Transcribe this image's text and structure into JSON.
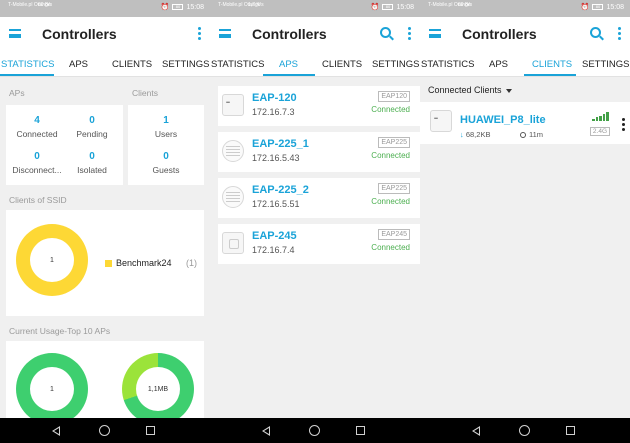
{
  "colors": {
    "accent": "#1aa3d8",
    "connected": "#4caf50",
    "donut_yellow": "#fdd835",
    "donut_green": "#3ecf6f",
    "donut_lime": "#9be33a"
  },
  "status_bars": [
    {
      "carrier": "T-Mobile.pl Orange",
      "speed": "60 B/s",
      "time": "15:08",
      "battery": "80"
    },
    {
      "carrier": "T-Mobile.pl Orange",
      "speed": "1,7 K/s",
      "time": "15:08",
      "battery": "80"
    },
    {
      "carrier": "T-Mobile.pl Orange",
      "speed": "69 B/s",
      "time": "15:08",
      "battery": "80"
    }
  ],
  "app_title": "Controllers",
  "tabs": [
    "STATISTICS",
    "APS",
    "CLIENTS",
    "SETTINGS"
  ],
  "statistics": {
    "aps_header": "APs",
    "clients_header": "Clients",
    "aps": [
      {
        "value": "4",
        "label": "Connected"
      },
      {
        "value": "0",
        "label": "Pending"
      },
      {
        "value": "0",
        "label": "Disconnect..."
      },
      {
        "value": "0",
        "label": "Isolated"
      }
    ],
    "clients": [
      {
        "value": "1",
        "label": "Users"
      },
      {
        "value": "0",
        "label": "Guests"
      }
    ],
    "ssid_header": "Clients of SSID",
    "ssid_donut_value": "1",
    "ssid_legend": {
      "name": "Benchmark24",
      "count": "(1)"
    },
    "usage_header": "Current Usage-Top 10 APs",
    "usage_donuts": [
      {
        "label": "1",
        "fraction": 1.0
      },
      {
        "label": "1,1MB",
        "fraction": 0.7
      }
    ]
  },
  "aps_list": [
    {
      "name": "EAP-120",
      "ip": "172.16.7.3",
      "model": "EAP120",
      "status": "Connected",
      "icon": "ap-square-dots-icon"
    },
    {
      "name": "EAP-225_1",
      "ip": "172.16.5.43",
      "model": "EAP225",
      "status": "Connected",
      "icon": "ap-round-icon"
    },
    {
      "name": "EAP-225_2",
      "ip": "172.16.5.51",
      "model": "EAP225",
      "status": "Connected",
      "icon": "ap-round-icon"
    },
    {
      "name": "EAP-245",
      "ip": "172.16.7.4",
      "model": "EAP245",
      "status": "Connected",
      "icon": "ap-square-icon"
    }
  ],
  "clients_view": {
    "filter_label": "Connected Clients",
    "client": {
      "name": "HUAWEI_P8_lite",
      "downloaded": "68,2KB",
      "duration": "11m",
      "band": "2.4G",
      "signal_bars": 4
    }
  }
}
